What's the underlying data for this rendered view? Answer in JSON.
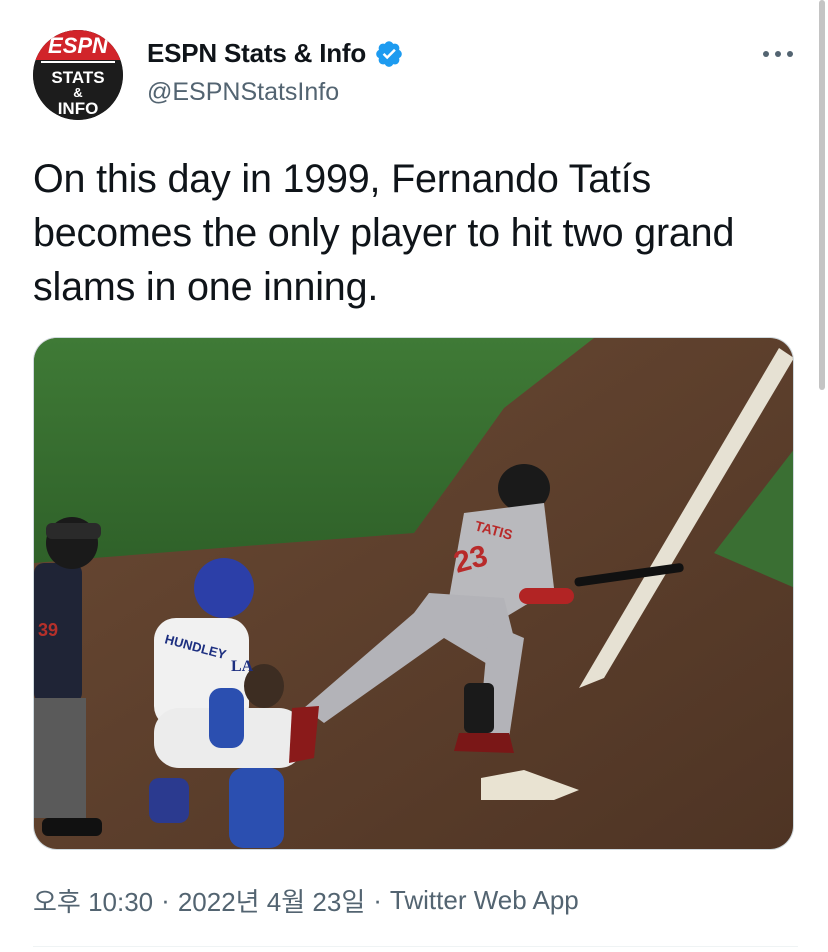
{
  "author": {
    "display_name": "ESPN Stats & Info",
    "handle": "@ESPNStatsInfo",
    "verified": true,
    "avatar_lines": [
      "ESPN",
      "STATS",
      "&",
      "INFO"
    ]
  },
  "tweet": {
    "text": "On this day in 1999, Fernando Tatís becomes the only player to hit two grand slams in one inning.",
    "media_player_name": "TATIS",
    "media_player_number": "23",
    "media_catcher_name": "HUNDLEY",
    "media_catcher_logo": "LA",
    "media_umpire_number": "39"
  },
  "meta": {
    "time": "오후 10:30",
    "separator": "·",
    "date": "2022년 4월 23일",
    "source": "Twitter Web App"
  },
  "colors": {
    "verified_blue": "#1d9bf0",
    "secondary_text": "#536471",
    "primary_text": "#0f1419"
  },
  "icons": {
    "more": "more-horizontal-icon",
    "verified": "verified-badge-icon"
  }
}
